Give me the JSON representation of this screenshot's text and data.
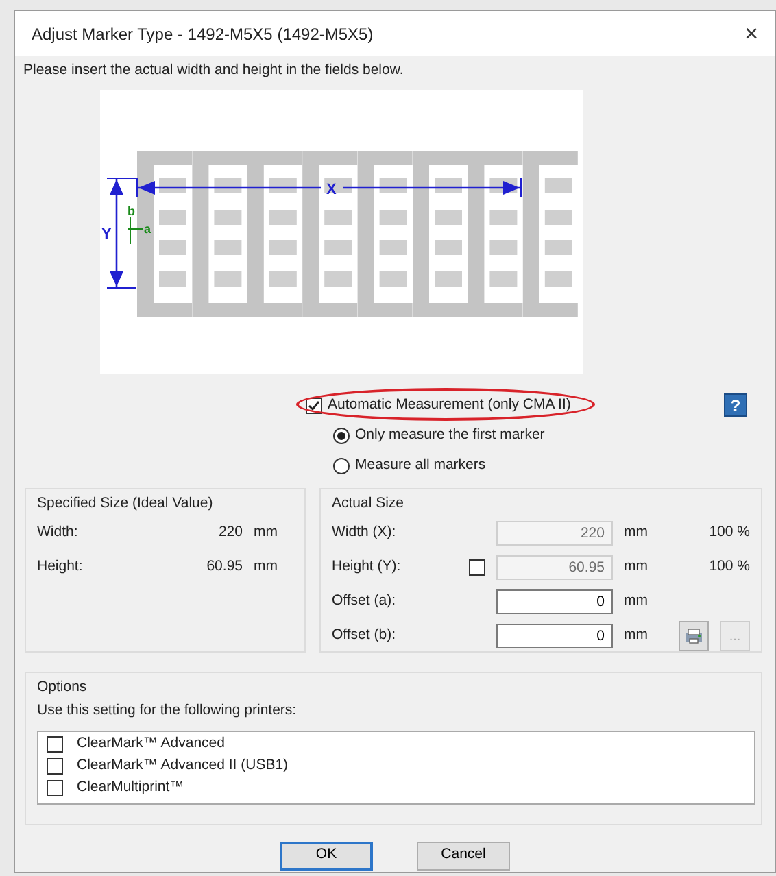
{
  "window": {
    "title": "Adjust Marker Type - 1492-M5X5 (1492-M5X5)",
    "close": "×"
  },
  "instruction": "Please insert the actual width and height in the fields below.",
  "diagram": {
    "x_label": "X",
    "y_label": "Y",
    "a_label": "a",
    "b_label": "b"
  },
  "auto_measurement": {
    "label": "Automatic Measurement (only CMA II)",
    "checked": true,
    "highlighted": true
  },
  "help_button": "?",
  "measure_mode": [
    {
      "label": "Only measure the first marker",
      "selected": true
    },
    {
      "label": "Measure all markers",
      "selected": false
    }
  ],
  "specified_size": {
    "title": "Specified Size (Ideal Value)",
    "rows": [
      {
        "label": "Width:",
        "value": "220",
        "unit": "mm"
      },
      {
        "label": "Height:",
        "value": "60.95",
        "unit": "mm"
      }
    ]
  },
  "actual_size": {
    "title": "Actual Size",
    "rows": [
      {
        "label": "Width (X):",
        "value": "220",
        "unit": "mm",
        "percent": "100 %",
        "disabled": true
      },
      {
        "label": "Height (Y):",
        "value": "60.95",
        "unit": "mm",
        "percent": "100 %",
        "disabled": true,
        "lock_checked": false
      },
      {
        "label": "Offset (a):",
        "value": "0",
        "unit": "mm",
        "disabled": false
      },
      {
        "label": "Offset (b):",
        "value": "0",
        "unit": "mm",
        "disabled": false
      }
    ],
    "more_button": "..."
  },
  "options": {
    "title": "Options",
    "hint": "Use this setting for the following printers:",
    "printers": [
      {
        "label": "ClearMark™ Advanced",
        "checked": false
      },
      {
        "label": "ClearMark™ Advanced II (USB1)",
        "checked": false
      },
      {
        "label": "ClearMultiprint™",
        "checked": false
      }
    ]
  },
  "buttons": [
    {
      "label": "OK",
      "default": true
    },
    {
      "label": "Cancel",
      "default": false
    }
  ]
}
